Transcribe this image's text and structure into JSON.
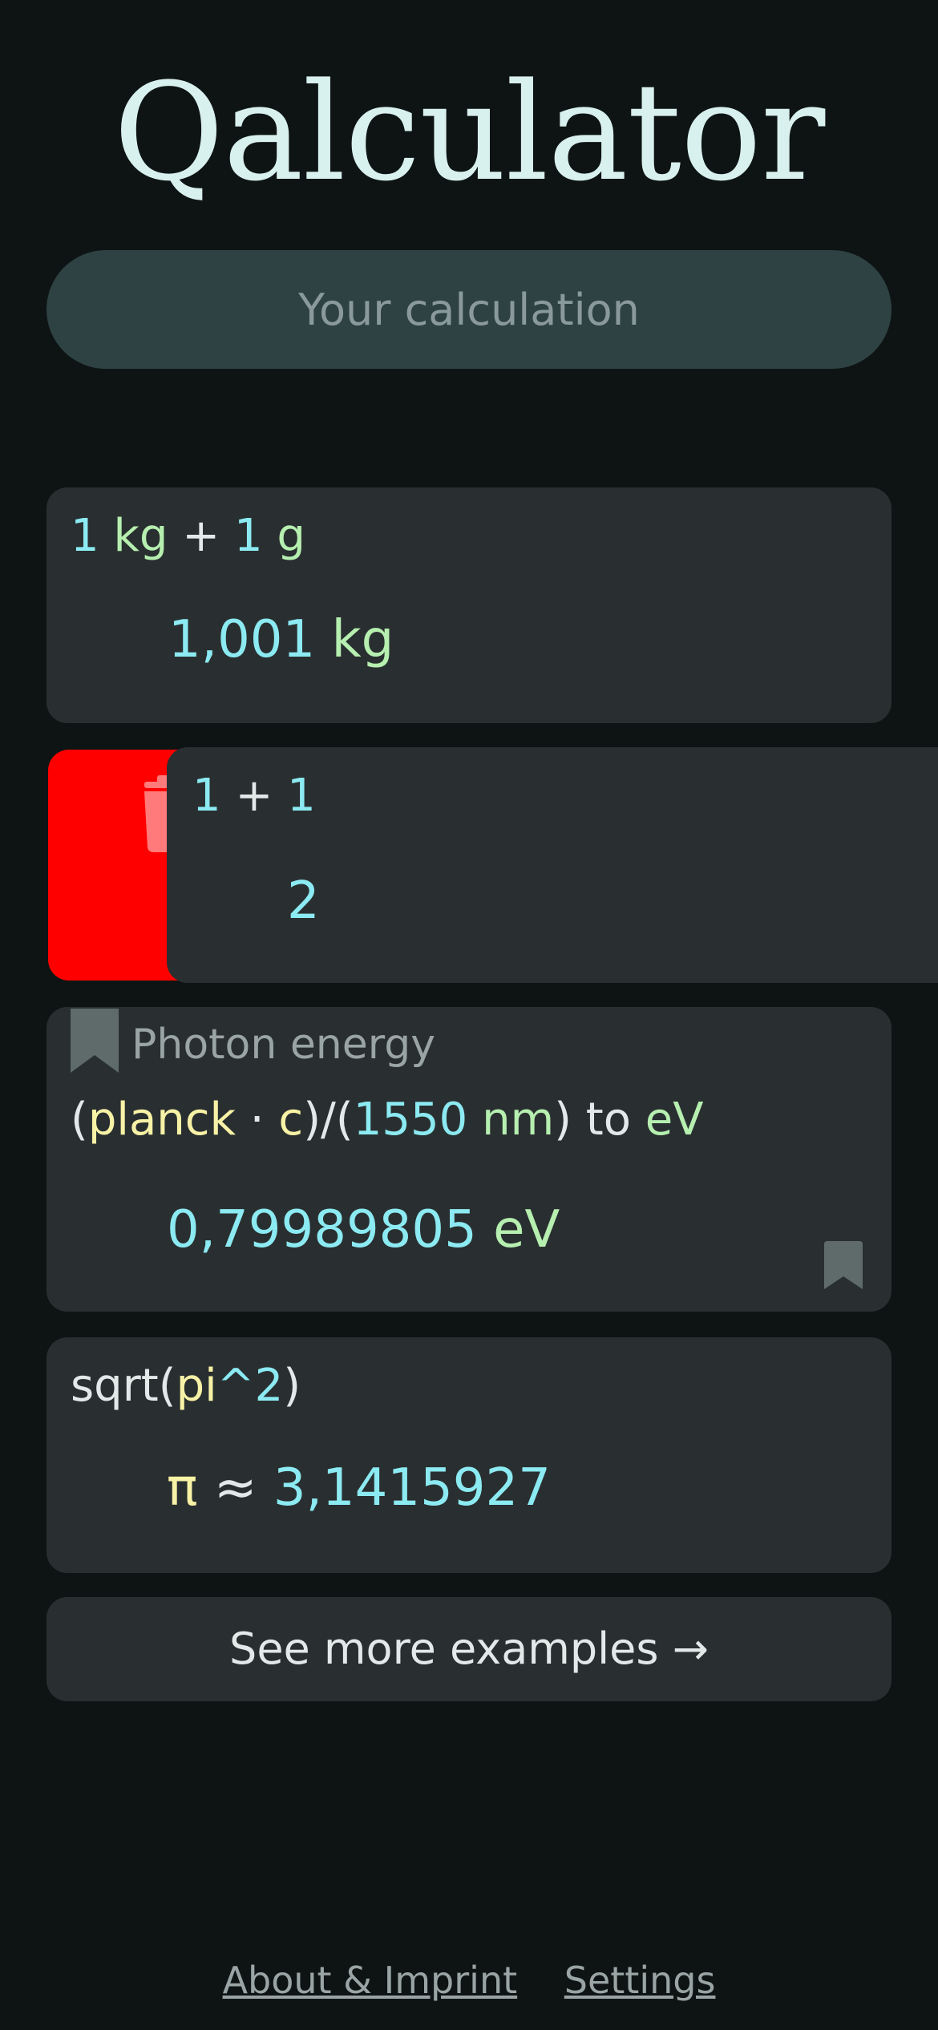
{
  "app": {
    "title": "Qalculator"
  },
  "input": {
    "placeholder": "Your calculation",
    "value": ""
  },
  "history": [
    {
      "expression": [
        {
          "text": "1",
          "kind": "num"
        },
        {
          "text": " kg",
          "kind": "unit"
        },
        {
          "text": " + ",
          "kind": "op"
        },
        {
          "text": "1",
          "kind": "num"
        },
        {
          "text": " g",
          "kind": "unit"
        }
      ],
      "result": [
        {
          "text": "1,001",
          "kind": "num"
        },
        {
          "text": " kg",
          "kind": "unit"
        }
      ]
    },
    {
      "expression": [
        {
          "text": "1",
          "kind": "num"
        },
        {
          "text": " + ",
          "kind": "op"
        },
        {
          "text": "1",
          "kind": "num"
        }
      ],
      "result": [
        {
          "text": "2",
          "kind": "num"
        }
      ],
      "swiped": true
    },
    {
      "bookmark_label": "Photon energy",
      "expression": [
        {
          "text": "(",
          "kind": "op"
        },
        {
          "text": "planck",
          "kind": "const"
        },
        {
          "text": " · ",
          "kind": "op"
        },
        {
          "text": "c",
          "kind": "const"
        },
        {
          "text": ")∕(",
          "kind": "op"
        },
        {
          "text": "1550",
          "kind": "num"
        },
        {
          "text": " nm",
          "kind": "unit"
        },
        {
          "text": ") to ",
          "kind": "op"
        },
        {
          "text": "eV",
          "kind": "unit"
        }
      ],
      "result": [
        {
          "text": "0,79989805",
          "kind": "num"
        },
        {
          "text": " eV",
          "kind": "unit"
        }
      ]
    },
    {
      "expression": [
        {
          "text": "sqrt(",
          "kind": "op"
        },
        {
          "text": "pi",
          "kind": "const"
        },
        {
          "text": "^2",
          "kind": "num"
        },
        {
          "text": ")",
          "kind": "op"
        }
      ],
      "result": [
        {
          "text": "π",
          "kind": "const"
        },
        {
          "text": " ≈ ",
          "kind": "op"
        },
        {
          "text": "3,1415927",
          "kind": "num"
        }
      ]
    }
  ],
  "actions": {
    "see_more": "See more examples →"
  },
  "footer": {
    "about": "About & Imprint",
    "settings": "Settings"
  },
  "icons": {
    "delete": "trash-icon",
    "bookmark": "bookmark-icon"
  },
  "colors": {
    "background": "#0e1414",
    "card": "#292f30",
    "input": "#2f4243",
    "delete": "#ff0000",
    "number": "#8ceaf2",
    "unit": "#b6efb0",
    "constant": "#f7f2a6",
    "text": "#e4e8e8"
  }
}
